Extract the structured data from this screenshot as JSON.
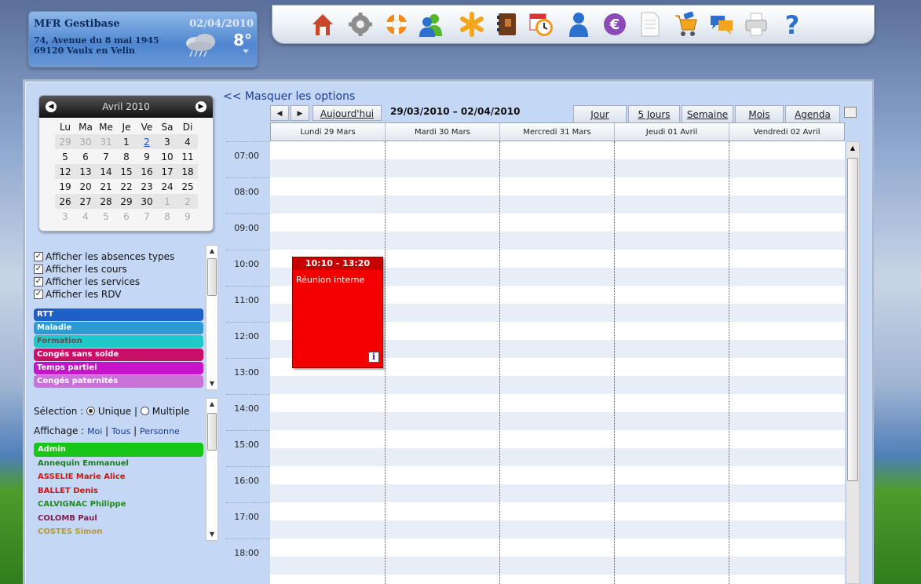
{
  "header": {
    "org_name": "MFR Gestibase",
    "address_line1": "74, Avenue du 8 mai 1945",
    "address_line2": "69120 Vaulx en Velin",
    "date": "02/04/2010",
    "temperature": "8°",
    "weather_icon": "cloud-rain-icon"
  },
  "toolbar": {
    "icons": [
      "home-icon",
      "settings-gear-icon",
      "help-lifebuoy-icon",
      "users-group-icon",
      "asterisk-icon",
      "address-book-icon",
      "calendar-clock-icon",
      "user-icon",
      "euro-icon",
      "document-icon",
      "shopping-cart-icon",
      "chat-bubbles-icon",
      "printer-icon",
      "help-question-icon"
    ]
  },
  "minical": {
    "month_label": "Avril 2010",
    "weekdays": [
      "Lu",
      "Ma",
      "Me",
      "Je",
      "Ve",
      "Sa",
      "Di"
    ],
    "weeks": [
      [
        "29",
        "30",
        "31",
        "1",
        "2",
        "3",
        "4"
      ],
      [
        "5",
        "6",
        "7",
        "8",
        "9",
        "10",
        "11"
      ],
      [
        "12",
        "13",
        "14",
        "15",
        "16",
        "17",
        "18"
      ],
      [
        "19",
        "20",
        "21",
        "22",
        "23",
        "24",
        "25"
      ],
      [
        "26",
        "27",
        "28",
        "29",
        "30",
        "1",
        "2"
      ],
      [
        "3",
        "4",
        "5",
        "6",
        "7",
        "8",
        "9"
      ]
    ],
    "today": "2"
  },
  "options": {
    "checkboxes": [
      "Afficher les absences types",
      "Afficher les cours",
      "Afficher les services",
      "Afficher les RDV"
    ],
    "absence_types": [
      {
        "label": "RTT",
        "color": "#1f5fc8"
      },
      {
        "label": "Maladie",
        "color": "#2d9ad2"
      },
      {
        "label": "Formation",
        "color": "#21c8c8"
      },
      {
        "label": "Congés sans solde",
        "color": "#c8106a"
      },
      {
        "label": "Temps partiel",
        "color": "#c814c8"
      },
      {
        "label": "Congés paternités",
        "color": "#c873d8"
      }
    ]
  },
  "selection": {
    "label": "Sélection :",
    "unique": "Unique",
    "multiple": "Multiple",
    "display_label": "Affichage :",
    "moi": "Moi",
    "tous": "Tous",
    "personne": "Personne",
    "sep": "|"
  },
  "people": [
    {
      "name": "Admin",
      "color": "#ffffff",
      "bg": "#17c617"
    },
    {
      "name": "Annequin Emmanuel",
      "color": "#1e7a1e"
    },
    {
      "name": "ASSELIE Marie Alice",
      "color": "#d01414"
    },
    {
      "name": "BALLET Denis",
      "color": "#d01414"
    },
    {
      "name": "CALVIGNAC Philippe",
      "color": "#1e8a1e"
    },
    {
      "name": "COLOMB Paul",
      "color": "#7a1e4a"
    },
    {
      "name": "COSTES Simon",
      "color": "#b89a2a"
    }
  ],
  "calendar": {
    "hide_options_link": "<< Masquer les options",
    "today_btn": "Aujourd'hui",
    "range": "29/03/2010 – 02/04/2010",
    "views": [
      "Jour",
      "5 Jours",
      "Semaine",
      "Mois",
      "Agenda"
    ],
    "days": [
      "Lundi 29 Mars",
      "Mardi 30 Mars",
      "Mercredi 31 Mars",
      "Jeudi 01 Avril",
      "Vendredi 02 Avril"
    ],
    "hours": [
      "07:00",
      "08:00",
      "09:00",
      "10:00",
      "11:00",
      "12:00",
      "13:00",
      "14:00",
      "15:00",
      "16:00",
      "17:00",
      "18:00"
    ],
    "event": {
      "time": "10:10 - 13:20",
      "title": "Réunion interne",
      "info": "i"
    }
  }
}
